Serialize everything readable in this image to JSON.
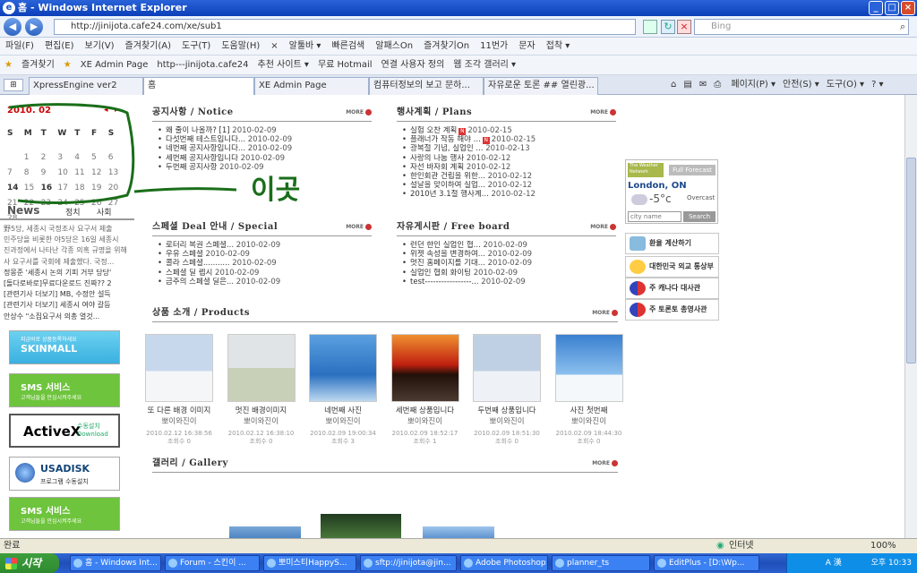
{
  "window": {
    "title": "홈 - Windows Internet Explorer",
    "icon_glyph": "e",
    "min_label": "_",
    "max_label": "□",
    "close_label": "×"
  },
  "address": {
    "url": "http://jinijota.cafe24.com/xe/sub1",
    "search_placeholder": "Bing"
  },
  "menu": [
    "파일(F)",
    "편집(E)",
    "보기(V)",
    "즐겨찾기(A)",
    "도구(T)",
    "도움말(H)",
    "×",
    "알툴바 ▾",
    "빠른검색",
    "알패스On",
    "즐겨찾기On",
    "11번가",
    "문자",
    "접착 ▾"
  ],
  "favorites": [
    "즐겨찾기",
    "XE Admin Page",
    "http---jinijota.cafe24",
    "추천 사이트 ▾",
    "무료 Hotmail",
    "연결 사용자 정의",
    "웹 조각 갤러리 ▾"
  ],
  "tabs": [
    "XpressEngine ver2",
    "홈",
    "XE Admin Page",
    "컴퓨터정보의 보고 문하...",
    "자유로운 토론 ## 열린광..."
  ],
  "tab_tools": [
    "페이지(P) ▾",
    "안전(S) ▾",
    "도구(O) ▾",
    "? ▾"
  ],
  "calendar": {
    "month": "2010. 02",
    "prev": "◂",
    "next": "▸",
    "days": [
      "S",
      "M",
      "T",
      "W",
      "T",
      "F",
      "S"
    ],
    "dates": [
      "",
      "1",
      "2",
      "3",
      "4",
      "5",
      "6",
      "7",
      "8",
      "9",
      "10",
      "11",
      "12",
      "13",
      "14",
      "15",
      "16",
      "17",
      "18",
      "19",
      "20",
      "21",
      "22",
      "23",
      "24",
      "25",
      "26",
      "27",
      "28"
    ],
    "annotation": "이곳"
  },
  "more_label": "MORE",
  "notice": {
    "title": "공지사항 / Notice",
    "items": [
      {
        "t": "왜 줄이 나올까? [1]",
        "d": "2010-02-09"
      },
      {
        "t": "다섯번째 테스트입니다...",
        "d": "2010-02-09"
      },
      {
        "t": "네번째 공지사항입니다...",
        "d": "2010-02-09"
      },
      {
        "t": "세번째 공지사항입니다",
        "d": "2010-02-09"
      },
      {
        "t": "두번째 공지사항",
        "d": "2010-02-09"
      }
    ]
  },
  "plans": {
    "title": "행사계획 / Plans",
    "items": [
      {
        "t": "실험 오찬 계획",
        "d": "2010-02-15",
        "n": true
      },
      {
        "t": "플래너가 작동 해야 ...",
        "d": "2010-02-15",
        "n": true
      },
      {
        "t": "광복절 기념, 실업인 ...",
        "d": "2010-02-13"
      },
      {
        "t": "사랑의 나눔 행사",
        "d": "2010-02-12"
      },
      {
        "t": "자선 바자회 계획",
        "d": "2010-02-12"
      },
      {
        "t": "한인회관 건립을 위한...",
        "d": "2010-02-12"
      },
      {
        "t": "설날을 맞이하여 실업...",
        "d": "2010-02-12"
      },
      {
        "t": "2010년 3.1절 행사계...",
        "d": "2010-02-12"
      }
    ]
  },
  "deal": {
    "title": "스페셜 Deal 안내 / Special",
    "items": [
      {
        "t": "로터리 복권 스페셜...",
        "d": "2010-02-09"
      },
      {
        "t": "우유 스페셜",
        "d": "2010-02-09"
      },
      {
        "t": "콜라 스페셜...........",
        "d": "2010-02-09"
      },
      {
        "t": "스페셜 딜 렙시",
        "d": "2010-02-09"
      },
      {
        "t": "금주의 스페셜 딜은...",
        "d": "2010-02-09"
      }
    ]
  },
  "board": {
    "title": "자유게시판 / Free board",
    "items": [
      {
        "t": "런던 한인 실업인 협...",
        "d": "2010-02-09"
      },
      {
        "t": "위젯 속성을 변경하여...",
        "d": "2010-02-09"
      },
      {
        "t": "멋진 홈페이지를 기대...",
        "d": "2010-02-09"
      },
      {
        "t": "실업인 협회 화이팅",
        "d": "2010-02-09"
      },
      {
        "t": "test-----------------...",
        "d": "2010-02-09"
      }
    ]
  },
  "products": {
    "title": "상품 소개 / Products",
    "items": [
      {
        "t": "또 다른 배경 이미지",
        "w": "뽀이와진이",
        "dt": "2010.02.12 16:38:56",
        "c": "조회수 0"
      },
      {
        "t": "멋진 배경이미지",
        "w": "뽀이와진이",
        "dt": "2010.02.12 16:38:10",
        "c": "조회수 0"
      },
      {
        "t": "네번째 사진",
        "w": "뽀이와진이",
        "dt": "2010.02.09 19:00:34",
        "c": "조회수 3"
      },
      {
        "t": "세번째 상품입니다",
        "w": "뽀이와진이",
        "dt": "2010.02.09 18:52:17",
        "c": "조회수 1"
      },
      {
        "t": "두번째 상품입니다",
        "w": "뽀이와진이",
        "dt": "2010.02.09 18:51:30",
        "c": "조회수 0"
      },
      {
        "t": "사진 첫번째",
        "w": "뽀이와진이",
        "dt": "2010.02.09 18:44:30",
        "c": "조회수 0"
      }
    ]
  },
  "gallery": {
    "title": "갤러리 / Gallery"
  },
  "news": {
    "tab": "News",
    "tab2": "정치",
    "tab3": "사회",
    "lines": [
      "野5당, 세종시 국정조사 요구서 제출",
      "민주당을 비롯한 야5당은 16일 세종시",
      "진과정에서 나타난 각종 의혹 규명을 위해",
      "사 요구서를 국회에 제출했다. 국정...",
      "정몽준 '세종시 논의 기피 거부 당당'",
      "[돌다로바로]무료다운로드 진짜?? 2",
      "[관련기사 더보기] MB, 수정안 설득",
      "[관련기사 더보기] 세종시 여야 갈등",
      "안상수 \"소집요구서 의총 열것..."
    ]
  },
  "banners": [
    {
      "label": "SKINMALL",
      "sub": "지금바로 상품등록하세요"
    },
    {
      "label": "SMS 서비스",
      "sub": "고객님들을 안심시켜주세요"
    },
    {
      "label": "ActiveX",
      "sub": "수동설치 Download"
    },
    {
      "label": "USADISK",
      "sub": "프로그램 수동설치"
    },
    {
      "label": "SMS 서비스",
      "sub": "고객님들을 안심시켜주세요"
    }
  ],
  "weather": {
    "brand": "The Weather Network",
    "forecast": "Full Forecast",
    "city": "London, ON",
    "temp": "-5°c",
    "cond": "Overcast",
    "input_placeholder": "city name",
    "search": "Search"
  },
  "links": [
    "환율 계산하기",
    "대한민국 외교 통상부",
    "주 캐나다 대사관",
    "주 토론토 총영사관"
  ],
  "status": {
    "left": "완료",
    "zone": "인터넷",
    "zoom": "100%"
  },
  "taskbar": {
    "start": "시작",
    "tasks": [
      "홈 - Windows Int...",
      "Forum - 스킨이 ...",
      "뽀미스티HappyS...",
      "sftp://jinijota@jin...",
      "Adobe Photoshop",
      "planner_ts",
      "EditPlus - [D:\\Wp..."
    ],
    "lang": "A 漢",
    "clock": "오후 10:33"
  }
}
